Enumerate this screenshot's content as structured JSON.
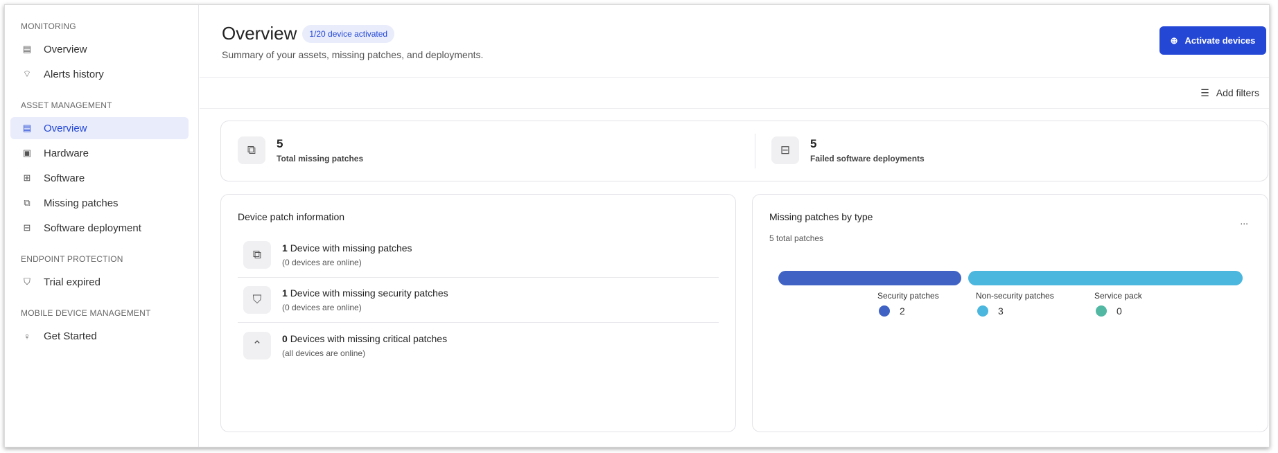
{
  "sidebar": {
    "sections": [
      {
        "title": "MONITORING",
        "items": [
          {
            "label": "Overview",
            "icon": "dashboard-icon"
          },
          {
            "label": "Alerts history",
            "icon": "satellite-icon"
          }
        ]
      },
      {
        "title": "ASSET MANAGEMENT",
        "items": [
          {
            "label": "Overview",
            "icon": "dashboard-icon",
            "active": true
          },
          {
            "label": "Hardware",
            "icon": "chip-icon"
          },
          {
            "label": "Software",
            "icon": "apps-icon"
          },
          {
            "label": "Missing patches",
            "icon": "patch-icon"
          },
          {
            "label": "Software deployment",
            "icon": "deploy-icon"
          }
        ]
      },
      {
        "title": "ENDPOINT PROTECTION",
        "items": [
          {
            "label": "Trial expired",
            "icon": "shield-icon"
          }
        ]
      },
      {
        "title": "MOBILE DEVICE MANAGEMENT",
        "items": [
          {
            "label": "Get Started",
            "icon": "bulb-icon"
          }
        ]
      }
    ]
  },
  "header": {
    "title": "Overview",
    "badge": "1/20 device activated",
    "subtitle": "Summary of your assets, missing patches, and deployments.",
    "activate": "Activate devices"
  },
  "filters": {
    "label": "Add filters"
  },
  "stats": [
    {
      "value": "5",
      "label": "Total missing patches"
    },
    {
      "value": "5",
      "label": "Failed software deployments"
    }
  ],
  "device_patch": {
    "title": "Device patch information",
    "rows": [
      {
        "count": "1",
        "text": "Device with missing patches",
        "sub": "(0 devices are online)"
      },
      {
        "count": "1",
        "text": "Device with missing security patches",
        "sub": "(0 devices are online)"
      },
      {
        "count": "0",
        "text": "Devices with missing critical patches",
        "sub": "(all devices are online)"
      }
    ]
  },
  "by_type": {
    "title": "Missing patches by type",
    "subtitle": "5 total patches",
    "menu": "...",
    "series": [
      {
        "name": "Security patches",
        "value": "2",
        "color": "#3f62c4"
      },
      {
        "name": "Non-security patches",
        "value": "3",
        "color": "#4bb6de"
      },
      {
        "name": "Service pack",
        "value": "0",
        "color": "#52b8a3"
      }
    ]
  }
}
